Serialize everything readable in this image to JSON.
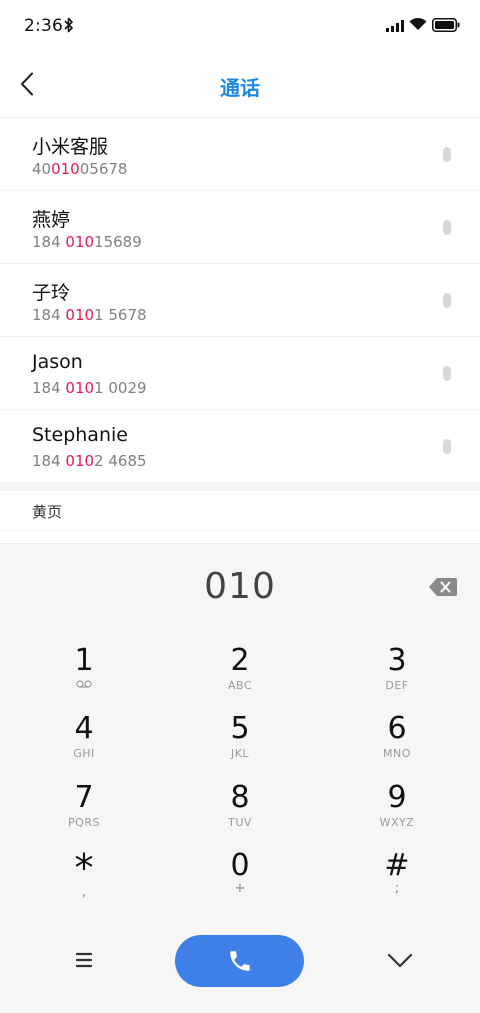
{
  "status_bar": {
    "time": "2:36",
    "icons": [
      "bluetooth-icon",
      "signal-icon",
      "wifi-icon",
      "battery-icon"
    ]
  },
  "header": {
    "title": "通话",
    "back_icon": "chevron-left-icon"
  },
  "results": [
    {
      "name": "小米客服",
      "number_pre": "40",
      "number_match": "010",
      "number_post": "05678"
    },
    {
      "name": "燕婷",
      "number_pre": "184 ",
      "number_match": "010",
      "number_post": "15689"
    },
    {
      "name": "子玲",
      "number_pre": "184 ",
      "number_match": "010",
      "number_post": "1 5678"
    },
    {
      "name": "Jason",
      "number_pre": "184 ",
      "number_match": "010",
      "number_post": "1 0029"
    },
    {
      "name": "Stephanie",
      "number_pre": "184 ",
      "number_match": "010",
      "number_post": "2 4685"
    }
  ],
  "yellow_pages": {
    "label": "黄页"
  },
  "dialpad": {
    "input": "010",
    "keys": [
      {
        "digit": "1",
        "sub": "voicemail-icon"
      },
      {
        "digit": "2",
        "sub": "ABC"
      },
      {
        "digit": "3",
        "sub": "DEF"
      },
      {
        "digit": "4",
        "sub": "GHI"
      },
      {
        "digit": "5",
        "sub": "JKL"
      },
      {
        "digit": "6",
        "sub": "MNO"
      },
      {
        "digit": "7",
        "sub": "PQRS"
      },
      {
        "digit": "8",
        "sub": "TUV"
      },
      {
        "digit": "9",
        "sub": "WXYZ"
      },
      {
        "digit": "*",
        "sub": ","
      },
      {
        "digit": "0",
        "sub": "+"
      },
      {
        "digit": "#",
        "sub": ";"
      }
    ],
    "bottom_icons": [
      "menu-icon",
      "phone-icon",
      "chevron-down-icon"
    ]
  },
  "colors": {
    "accent": "#1e88e5",
    "match_highlight": "#e5194f",
    "call_button": "#3e7fe8"
  }
}
